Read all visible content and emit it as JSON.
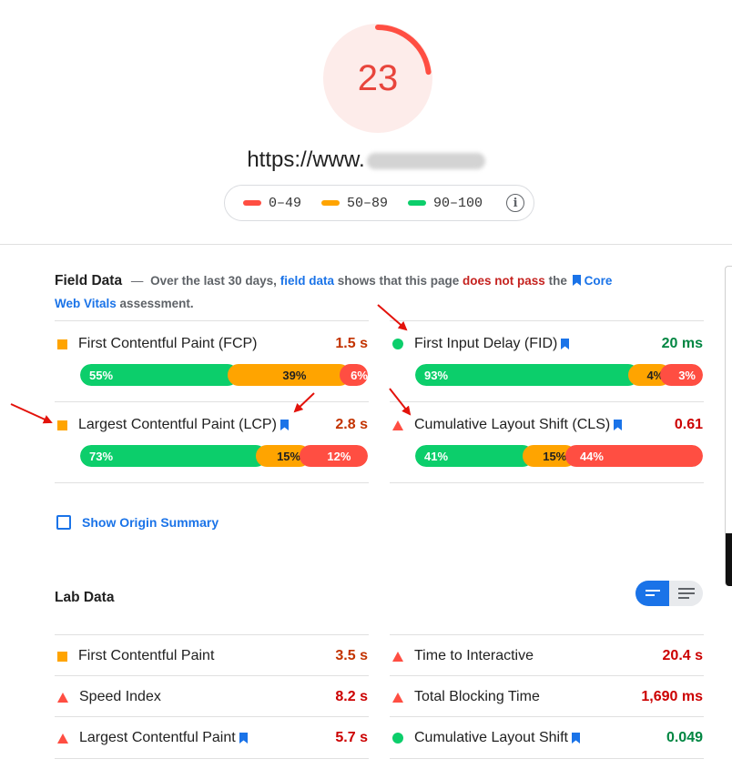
{
  "score": {
    "value": "23",
    "fraction": 0.23,
    "color": "#e8453c"
  },
  "url": {
    "text": "https://www."
  },
  "legend": {
    "items": [
      {
        "label": "0–49",
        "color": "#ff4e42"
      },
      {
        "label": "50–89",
        "color": "#ffa400"
      },
      {
        "label": "90–100",
        "color": "#0cce6b"
      }
    ],
    "info_icon": "info-icon"
  },
  "field_data": {
    "title": "Field Data",
    "dash": "—",
    "text1": "Over the last 30 days,",
    "link": "field data",
    "text2": "shows that this page",
    "fail": "does not pass",
    "text3": "the",
    "cwv_link": "Core Web Vitals",
    "text4": "assessment.",
    "metrics": [
      {
        "name": "First Contentful Paint (FCP)",
        "value": "1.5 s",
        "icon": "square-icon",
        "good": "55%",
        "avg": "39%",
        "poor": "6%",
        "good_pct": 55,
        "avg_pct": 39,
        "poor_pct": 6
      },
      {
        "name": "First Input Delay (FID)",
        "value": "20 ms",
        "icon": "circle-icon",
        "good": "93%",
        "avg": "4%",
        "poor": "3%",
        "good_pct": 93,
        "avg_pct": 4,
        "poor_pct": 3
      },
      {
        "name": "Largest Contentful Paint (LCP)",
        "value": "2.8 s",
        "icon": "square-icon",
        "good": "73%",
        "avg": "15%",
        "poor": "12%",
        "good_pct": 73,
        "avg_pct": 15,
        "poor_pct": 12
      },
      {
        "name": "Cumulative Layout Shift (CLS)",
        "value": "0.61",
        "icon": "triangle-icon",
        "good": "41%",
        "avg": "15%",
        "poor": "44%",
        "good_pct": 41,
        "avg_pct": 15,
        "poor_pct": 44
      }
    ]
  },
  "origin_summary": {
    "label": "Show Origin Summary"
  },
  "lab_data": {
    "title": "Lab Data",
    "metrics": [
      {
        "name": "First Contentful Paint",
        "value": "3.5 s"
      },
      {
        "name": "Time to Interactive",
        "value": "20.4 s"
      },
      {
        "name": "Speed Index",
        "value": "8.2 s"
      },
      {
        "name": "Total Blocking Time",
        "value": "1,690 ms"
      },
      {
        "name": "Largest Contentful Paint",
        "value": "5.7 s"
      },
      {
        "name": "Cumulative Layout Shift",
        "value": "0.049"
      }
    ]
  },
  "colors": {
    "good": "#0cce6b",
    "average": "#ffa400",
    "poor": "#ff4e42",
    "link": "#1a73e8",
    "annotation_arrow": "#e3120b"
  }
}
